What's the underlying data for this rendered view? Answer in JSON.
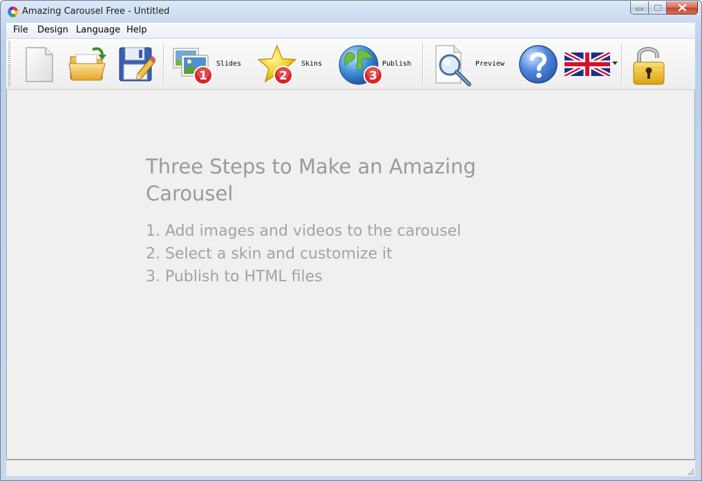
{
  "window": {
    "title": "Amazing Carousel Free - Untitled",
    "icon": "amazing-carousel-app-icon"
  },
  "caption_buttons": [
    "minimize-icon",
    "maximize-icon",
    "close-icon"
  ],
  "menubar": {
    "items": [
      "File",
      "Design",
      "Language",
      "Help"
    ]
  },
  "toolbar": {
    "new_icon": "new-document-icon",
    "open_icon": "open-folder-icon",
    "save_icon": "save-disk-icon",
    "slides": {
      "label": "Slides",
      "step": "1",
      "icon": "slides-pictures-icon"
    },
    "skins": {
      "label": "Skins",
      "step": "2",
      "icon": "star-icon"
    },
    "publish": {
      "label": "Publish",
      "step": "3",
      "icon": "globe-icon"
    },
    "preview": {
      "label": "Preview",
      "icon": "preview-magnifier-icon"
    },
    "help_icon": "help-question-icon",
    "language_icon": "uk-flag-icon",
    "unlock_icon": "unlock-padlock-icon"
  },
  "welcome": {
    "title": "Three Steps to Make an Amazing Carousel",
    "steps": [
      "1. Add images and videos to the carousel",
      "2. Select a skin and customize it",
      "3. Publish to HTML files"
    ]
  },
  "colors": {
    "workspace_bg": "#f0f0f0",
    "welcome_text": "#9a9a9a",
    "badge_red": "#d9262a"
  }
}
